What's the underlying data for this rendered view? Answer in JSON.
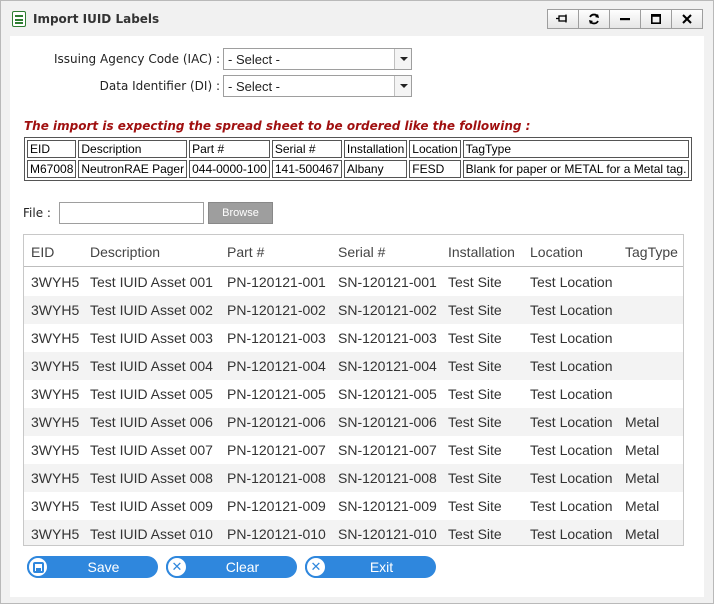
{
  "window": {
    "title": "Import IUID Labels",
    "title_buttons": [
      "pin-icon",
      "refresh-icon",
      "minimize-icon",
      "maximize-icon",
      "close-icon"
    ]
  },
  "form": {
    "iac": {
      "label": "Issuing Agency Code (IAC) :",
      "value": "- Select -"
    },
    "di": {
      "label": "Data Identifier (DI) :",
      "value": "- Select -"
    }
  },
  "notice": "The import is expecting the spread sheet to be ordered like the following :",
  "sample": {
    "headers": [
      "EID",
      "Description",
      "Part #",
      "Serial #",
      "Installation",
      "Location",
      "TagType"
    ],
    "row": [
      "M67008",
      "NeutronRAE Pager",
      "044-0000-100",
      "141-500467",
      "Albany",
      "FESD",
      "Blank for paper or METAL for a Metal tag."
    ]
  },
  "file": {
    "label": "File :",
    "value": "",
    "browse_label": "Browse"
  },
  "grid": {
    "headers": {
      "eid": "EID",
      "description": "Description",
      "part": "Part #",
      "serial": "Serial #",
      "installation": "Installation",
      "location": "Location",
      "tagtype": "TagType"
    },
    "rows": [
      {
        "eid": "3WYH5",
        "description": "Test IUID Asset 001",
        "part": "PN-120121-001",
        "serial": "SN-120121-001",
        "installation": "Test Site",
        "location": "Test Location",
        "tagtype": ""
      },
      {
        "eid": "3WYH5",
        "description": "Test IUID Asset 002",
        "part": "PN-120121-002",
        "serial": "SN-120121-002",
        "installation": "Test Site",
        "location": "Test Location",
        "tagtype": ""
      },
      {
        "eid": "3WYH5",
        "description": "Test IUID Asset 003",
        "part": "PN-120121-003",
        "serial": "SN-120121-003",
        "installation": "Test Site",
        "location": "Test Location",
        "tagtype": ""
      },
      {
        "eid": "3WYH5",
        "description": "Test IUID Asset 004",
        "part": "PN-120121-004",
        "serial": "SN-120121-004",
        "installation": "Test Site",
        "location": "Test Location",
        "tagtype": ""
      },
      {
        "eid": "3WYH5",
        "description": "Test IUID Asset 005",
        "part": "PN-120121-005",
        "serial": "SN-120121-005",
        "installation": "Test Site",
        "location": "Test Location",
        "tagtype": ""
      },
      {
        "eid": "3WYH5",
        "description": "Test IUID Asset 006",
        "part": "PN-120121-006",
        "serial": "SN-120121-006",
        "installation": "Test Site",
        "location": "Test Location",
        "tagtype": "Metal"
      },
      {
        "eid": "3WYH5",
        "description": "Test IUID Asset 007",
        "part": "PN-120121-007",
        "serial": "SN-120121-007",
        "installation": "Test Site",
        "location": "Test Location",
        "tagtype": "Metal"
      },
      {
        "eid": "3WYH5",
        "description": "Test IUID Asset 008",
        "part": "PN-120121-008",
        "serial": "SN-120121-008",
        "installation": "Test Site",
        "location": "Test Location",
        "tagtype": "Metal"
      },
      {
        "eid": "3WYH5",
        "description": "Test IUID Asset 009",
        "part": "PN-120121-009",
        "serial": "SN-120121-009",
        "installation": "Test Site",
        "location": "Test Location",
        "tagtype": "Metal"
      },
      {
        "eid": "3WYH5",
        "description": "Test IUID Asset 010",
        "part": "PN-120121-010",
        "serial": "SN-120121-010",
        "installation": "Test Site",
        "location": "Test Location",
        "tagtype": "Metal"
      }
    ]
  },
  "actions": {
    "save": "Save",
    "clear": "Clear",
    "exit": "Exit"
  },
  "colors": {
    "accent": "#2f87dd",
    "notice": "#a01010",
    "title_icon": "#2e7d32"
  }
}
